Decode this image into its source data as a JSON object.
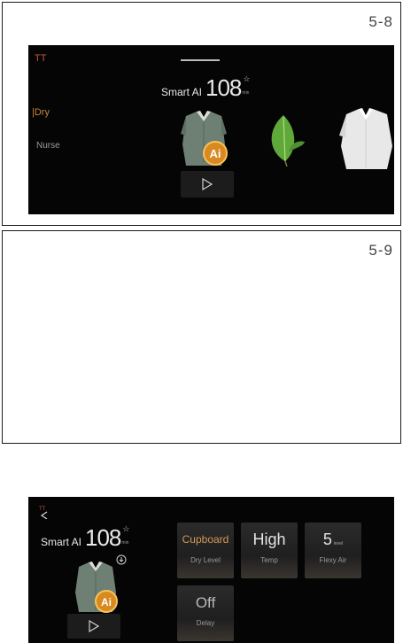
{
  "figures": [
    {
      "label": "5-8"
    },
    {
      "label": "5-9"
    }
  ],
  "screen1": {
    "back_icon": "TT",
    "program_label": "Smart AI",
    "time_value": "108",
    "time_unit": "min",
    "menu": [
      {
        "label": "|Dry"
      },
      {
        "label": "Nurse"
      }
    ],
    "ai_badge": "Ai",
    "icons": [
      "shirt-ai-icon",
      "leaf-icon",
      "white-shirt-icon",
      "play-icon"
    ]
  },
  "screen2": {
    "back_icon": "TT",
    "program_label": "Smart AI",
    "time_value": "108",
    "time_unit": "min",
    "ai_badge": "Ai",
    "tiles": [
      {
        "value": "Cupboard",
        "label": "Dry Level"
      },
      {
        "value": "High",
        "label": "Temp"
      },
      {
        "value": "5",
        "unit": "level",
        "label": "Flexy Air"
      },
      {
        "value": "Off",
        "label": "Delay"
      }
    ],
    "colors": {
      "accent": "#d69a55",
      "screen_bg": "#050505",
      "tile_bg": "#262626"
    }
  }
}
